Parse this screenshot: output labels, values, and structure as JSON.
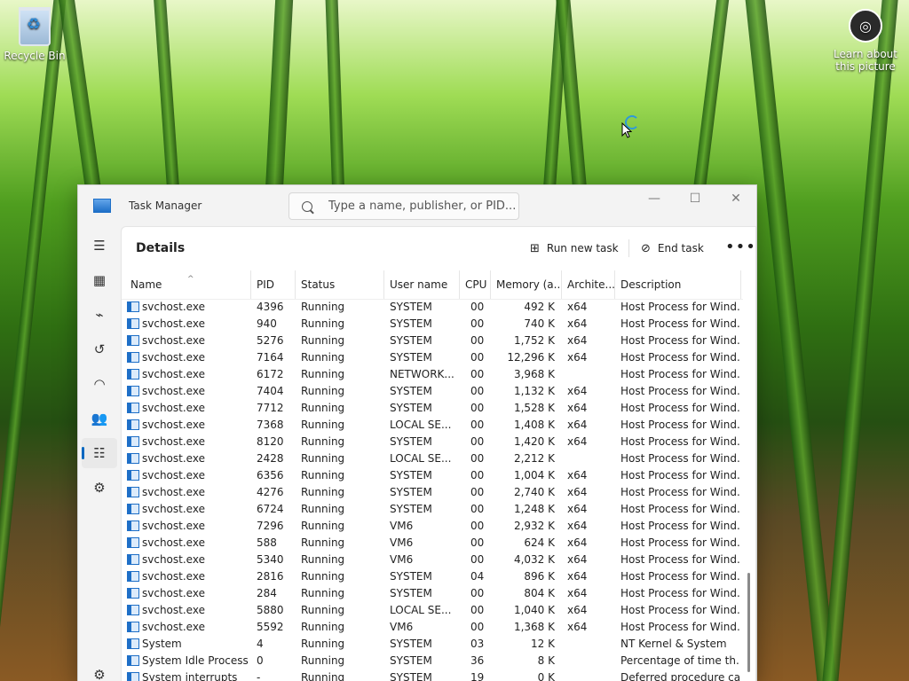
{
  "desktop": {
    "recycle_bin_label": "Recycle Bin",
    "learn_label": "Learn about this picture"
  },
  "app": {
    "title": "Task Manager",
    "search_placeholder": "Type a name, publisher, or PID...",
    "page_title": "Details",
    "run_new_task": "Run new task",
    "end_task": "End task",
    "more": "•••"
  },
  "columns": [
    "Name",
    "PID",
    "Status",
    "User name",
    "CPU",
    "Memory (a...",
    "Archite...",
    "Description"
  ],
  "rows": [
    {
      "name": "svchost.exe",
      "pid": "4396",
      "status": "Running",
      "user": "SYSTEM",
      "cpu": "00",
      "mem": "492 K",
      "arch": "x64",
      "desc": "Host Process for Wind..."
    },
    {
      "name": "svchost.exe",
      "pid": "940",
      "status": "Running",
      "user": "SYSTEM",
      "cpu": "00",
      "mem": "740 K",
      "arch": "x64",
      "desc": "Host Process for Wind..."
    },
    {
      "name": "svchost.exe",
      "pid": "5276",
      "status": "Running",
      "user": "SYSTEM",
      "cpu": "00",
      "mem": "1,752 K",
      "arch": "x64",
      "desc": "Host Process for Wind..."
    },
    {
      "name": "svchost.exe",
      "pid": "7164",
      "status": "Running",
      "user": "SYSTEM",
      "cpu": "00",
      "mem": "12,296 K",
      "arch": "x64",
      "desc": "Host Process for Wind..."
    },
    {
      "name": "svchost.exe",
      "pid": "6172",
      "status": "Running",
      "user": "NETWORK...",
      "cpu": "00",
      "mem": "3,968 K",
      "arch": "",
      "desc": "Host Process for Wind..."
    },
    {
      "name": "svchost.exe",
      "pid": "7404",
      "status": "Running",
      "user": "SYSTEM",
      "cpu": "00",
      "mem": "1,132 K",
      "arch": "x64",
      "desc": "Host Process for Wind..."
    },
    {
      "name": "svchost.exe",
      "pid": "7712",
      "status": "Running",
      "user": "SYSTEM",
      "cpu": "00",
      "mem": "1,528 K",
      "arch": "x64",
      "desc": "Host Process for Wind..."
    },
    {
      "name": "svchost.exe",
      "pid": "7368",
      "status": "Running",
      "user": "LOCAL SE...",
      "cpu": "00",
      "mem": "1,408 K",
      "arch": "x64",
      "desc": "Host Process for Wind..."
    },
    {
      "name": "svchost.exe",
      "pid": "8120",
      "status": "Running",
      "user": "SYSTEM",
      "cpu": "00",
      "mem": "1,420 K",
      "arch": "x64",
      "desc": "Host Process for Wind..."
    },
    {
      "name": "svchost.exe",
      "pid": "2428",
      "status": "Running",
      "user": "LOCAL SE...",
      "cpu": "00",
      "mem": "2,212 K",
      "arch": "",
      "desc": "Host Process for Wind..."
    },
    {
      "name": "svchost.exe",
      "pid": "6356",
      "status": "Running",
      "user": "SYSTEM",
      "cpu": "00",
      "mem": "1,004 K",
      "arch": "x64",
      "desc": "Host Process for Wind..."
    },
    {
      "name": "svchost.exe",
      "pid": "4276",
      "status": "Running",
      "user": "SYSTEM",
      "cpu": "00",
      "mem": "2,740 K",
      "arch": "x64",
      "desc": "Host Process for Wind..."
    },
    {
      "name": "svchost.exe",
      "pid": "6724",
      "status": "Running",
      "user": "SYSTEM",
      "cpu": "00",
      "mem": "1,248 K",
      "arch": "x64",
      "desc": "Host Process for Wind..."
    },
    {
      "name": "svchost.exe",
      "pid": "7296",
      "status": "Running",
      "user": "VM6",
      "cpu": "00",
      "mem": "2,932 K",
      "arch": "x64",
      "desc": "Host Process for Wind..."
    },
    {
      "name": "svchost.exe",
      "pid": "588",
      "status": "Running",
      "user": "VM6",
      "cpu": "00",
      "mem": "624 K",
      "arch": "x64",
      "desc": "Host Process for Wind..."
    },
    {
      "name": "svchost.exe",
      "pid": "5340",
      "status": "Running",
      "user": "VM6",
      "cpu": "00",
      "mem": "4,032 K",
      "arch": "x64",
      "desc": "Host Process for Wind..."
    },
    {
      "name": "svchost.exe",
      "pid": "2816",
      "status": "Running",
      "user": "SYSTEM",
      "cpu": "04",
      "mem": "896 K",
      "arch": "x64",
      "desc": "Host Process for Wind..."
    },
    {
      "name": "svchost.exe",
      "pid": "284",
      "status": "Running",
      "user": "SYSTEM",
      "cpu": "00",
      "mem": "804 K",
      "arch": "x64",
      "desc": "Host Process for Wind..."
    },
    {
      "name": "svchost.exe",
      "pid": "5880",
      "status": "Running",
      "user": "LOCAL SE...",
      "cpu": "00",
      "mem": "1,040 K",
      "arch": "x64",
      "desc": "Host Process for Wind..."
    },
    {
      "name": "svchost.exe",
      "pid": "5592",
      "status": "Running",
      "user": "VM6",
      "cpu": "00",
      "mem": "1,368 K",
      "arch": "x64",
      "desc": "Host Process for Wind..."
    },
    {
      "name": "System",
      "pid": "4",
      "status": "Running",
      "user": "SYSTEM",
      "cpu": "03",
      "mem": "12 K",
      "arch": "",
      "desc": "NT Kernel & System"
    },
    {
      "name": "System Idle Process",
      "pid": "0",
      "status": "Running",
      "user": "SYSTEM",
      "cpu": "36",
      "mem": "8 K",
      "arch": "",
      "desc": "Percentage of time th..."
    },
    {
      "name": "System interrupts",
      "pid": "-",
      "status": "Running",
      "user": "SYSTEM",
      "cpu": "19",
      "mem": "0 K",
      "arch": "",
      "desc": "Deferred procedure ca..."
    }
  ],
  "nav_icons": [
    "hamburger-menu-icon",
    "processes-icon",
    "performance-icon",
    "app-history-icon",
    "startup-apps-icon",
    "users-icon",
    "details-icon",
    "services-icon",
    "settings-icon"
  ],
  "colors": {
    "accent": "#0067c0",
    "window_bg": "#f3f3f3"
  }
}
